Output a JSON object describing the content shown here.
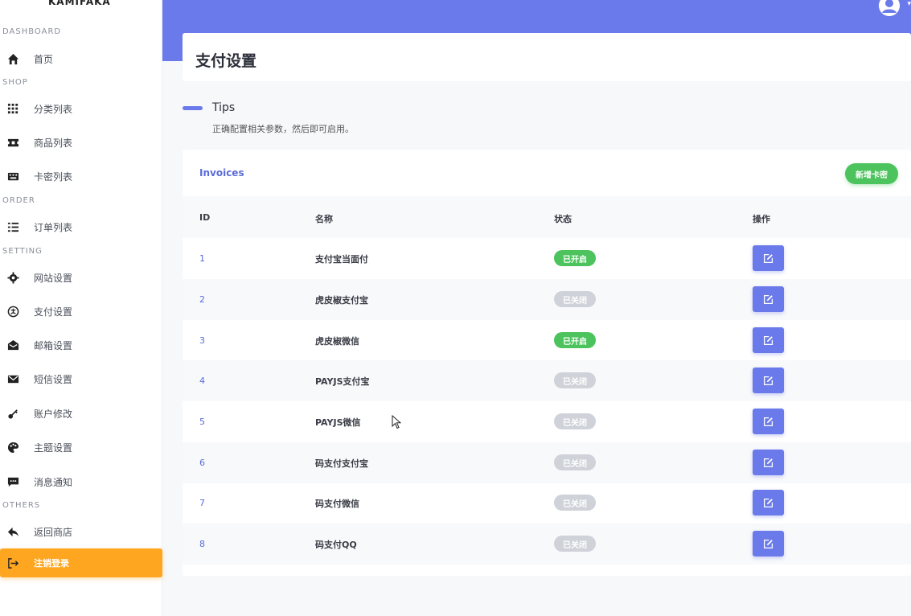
{
  "brand": "KAMIFAKA",
  "sidebar": {
    "sections": [
      {
        "label": "DASHBOARD"
      },
      {
        "label": "SHOP"
      },
      {
        "label": "ORDER"
      },
      {
        "label": "SETTING"
      },
      {
        "label": "OTHERS"
      }
    ],
    "items": [
      {
        "label": "首页",
        "icon": "home-icon"
      },
      {
        "label": "分类列表",
        "icon": "category-icon"
      },
      {
        "label": "商品列表",
        "icon": "ticket-icon"
      },
      {
        "label": "卡密列表",
        "icon": "keyboard-icon"
      },
      {
        "label": "订单列表",
        "icon": "list-icon"
      },
      {
        "label": "网站设置",
        "icon": "gear-icon"
      },
      {
        "label": "支付设置",
        "icon": "alipay-icon"
      },
      {
        "label": "邮箱设置",
        "icon": "mail-open-icon"
      },
      {
        "label": "短信设置",
        "icon": "envelope-icon"
      },
      {
        "label": "账户修改",
        "icon": "key-icon"
      },
      {
        "label": "主题设置",
        "icon": "palette-icon"
      },
      {
        "label": "消息通知",
        "icon": "message-icon"
      },
      {
        "label": "返回商店",
        "icon": "reply-icon"
      },
      {
        "label": "注销登录",
        "icon": "logout-icon"
      }
    ]
  },
  "page": {
    "title": "支付设置"
  },
  "tips": {
    "title": "Tips",
    "text": "正确配置相关参数，然后即可启用。"
  },
  "table": {
    "title": "Invoices",
    "add_label": "新增卡密",
    "columns": [
      "ID",
      "名称",
      "状态",
      "操作"
    ],
    "rows": [
      {
        "id": "1",
        "name": "支付宝当面付",
        "status": "已开启",
        "enabled": true
      },
      {
        "id": "2",
        "name": "虎皮椒支付宝",
        "status": "已关闭",
        "enabled": false
      },
      {
        "id": "3",
        "name": "虎皮椒微信",
        "status": "已开启",
        "enabled": true
      },
      {
        "id": "4",
        "name": "PAYJS支付宝",
        "status": "已关闭",
        "enabled": false
      },
      {
        "id": "5",
        "name": "PAYJS微信",
        "status": "已关闭",
        "enabled": false
      },
      {
        "id": "6",
        "name": "码支付支付宝",
        "status": "已关闭",
        "enabled": false
      },
      {
        "id": "7",
        "name": "码支付微信",
        "status": "已关闭",
        "enabled": false
      },
      {
        "id": "8",
        "name": "码支付QQ",
        "status": "已关闭",
        "enabled": false
      }
    ]
  },
  "colors": {
    "primary": "#6b7aea",
    "success": "#4cc35d",
    "muted": "#cfd2d8",
    "warning": "#ffa621"
  }
}
